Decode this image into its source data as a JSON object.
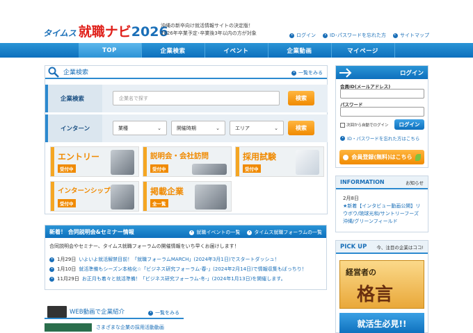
{
  "header": {
    "logo_prefix": "タイムス",
    "logo_main": "就職ナビ",
    "logo_year": "2026",
    "tagline_1": "沖縄の新卒向け就活情報サイトの決定版！",
    "tagline_2": "2026年卒業予定･卒業後3年以内の方が対象",
    "links": [
      "ログイン",
      "ID･パスワードを忘れた方",
      "サイトマップ"
    ]
  },
  "nav": [
    "TOP",
    "企業検索",
    "イベント",
    "企業動画",
    "マイページ"
  ],
  "search": {
    "title": "企業検索",
    "more": "一覧をみる",
    "company_label": "企業検索",
    "company_placeholder": "企業名で探す",
    "search_btn": "検索",
    "intern_label": "インターン",
    "industry": "業種",
    "period": "開催時期",
    "area": "エリア"
  },
  "tiles": [
    {
      "title": "エントリー",
      "badge": "受付中"
    },
    {
      "title": "説明会・会社訪問",
      "badge": "受付中"
    },
    {
      "title": "採用試験",
      "badge": "受付中"
    },
    {
      "title": "インターンシップ等",
      "badge": "受付中"
    },
    {
      "title": "掲載企業",
      "badge": "全一覧"
    }
  ],
  "seminar": {
    "title": "新着！ 合同説明会&セミナー情報",
    "link1": "就職イベントの一覧",
    "link2": "タイムス就職フォーラムの一覧",
    "intro": "合同説明会やセミナー、タイムス就職フォーラムの開催情報をいち早くお届けします！",
    "items": [
      {
        "date": "1月29日",
        "text": "いよいよ就活解禁目前！「就職フォーラムMARCH」(2024年3月1日)でスタートダッシュ！"
      },
      {
        "date": "1月10日",
        "text": "就活準備もシーズン本格化☆「ビジネス研究フォーラム-春-」(2024年2月14日)で情報収集もばっちり！"
      },
      {
        "date": "11月29日",
        "text": "お正月も着々と就活準備！「ビジネス研究フォーラム-冬-」(2024年1月13日)を開催します。"
      }
    ]
  },
  "video": {
    "title": "WEB動画で企業紹介",
    "more": "一覧をみる",
    "caption": "さまざまな企業の採用活動動画"
  },
  "login": {
    "title": "ログイン",
    "id_label": "会員ID(メールアドレス)",
    "pw_label": "パスワード",
    "auto": "次回から自動でログイン",
    "btn": "ログイン",
    "forgot": "ID・パスワードを忘れた方はこちら",
    "register": "会員登録(無料)はこちら"
  },
  "information": {
    "title": "INFORMATION",
    "link": "お知らせ",
    "date": "2月8日",
    "text": "★新着【インタビュー動画公開】リウボウ/琉球光和/サントリーフーズ沖縄/グリーンフィールド"
  },
  "pickup": {
    "title": "PICK UP",
    "subtitle": "今、注目の企業はココ!",
    "banner_1a": "経営者の",
    "banner_1b": "格言",
    "banner_2": "就活生必見!!"
  },
  "colors": {
    "brand_blue": "#1a6fb8",
    "nav_blue": "#0e70bd",
    "accent_orange": "#f08a00",
    "logo_red": "#e0201a"
  }
}
